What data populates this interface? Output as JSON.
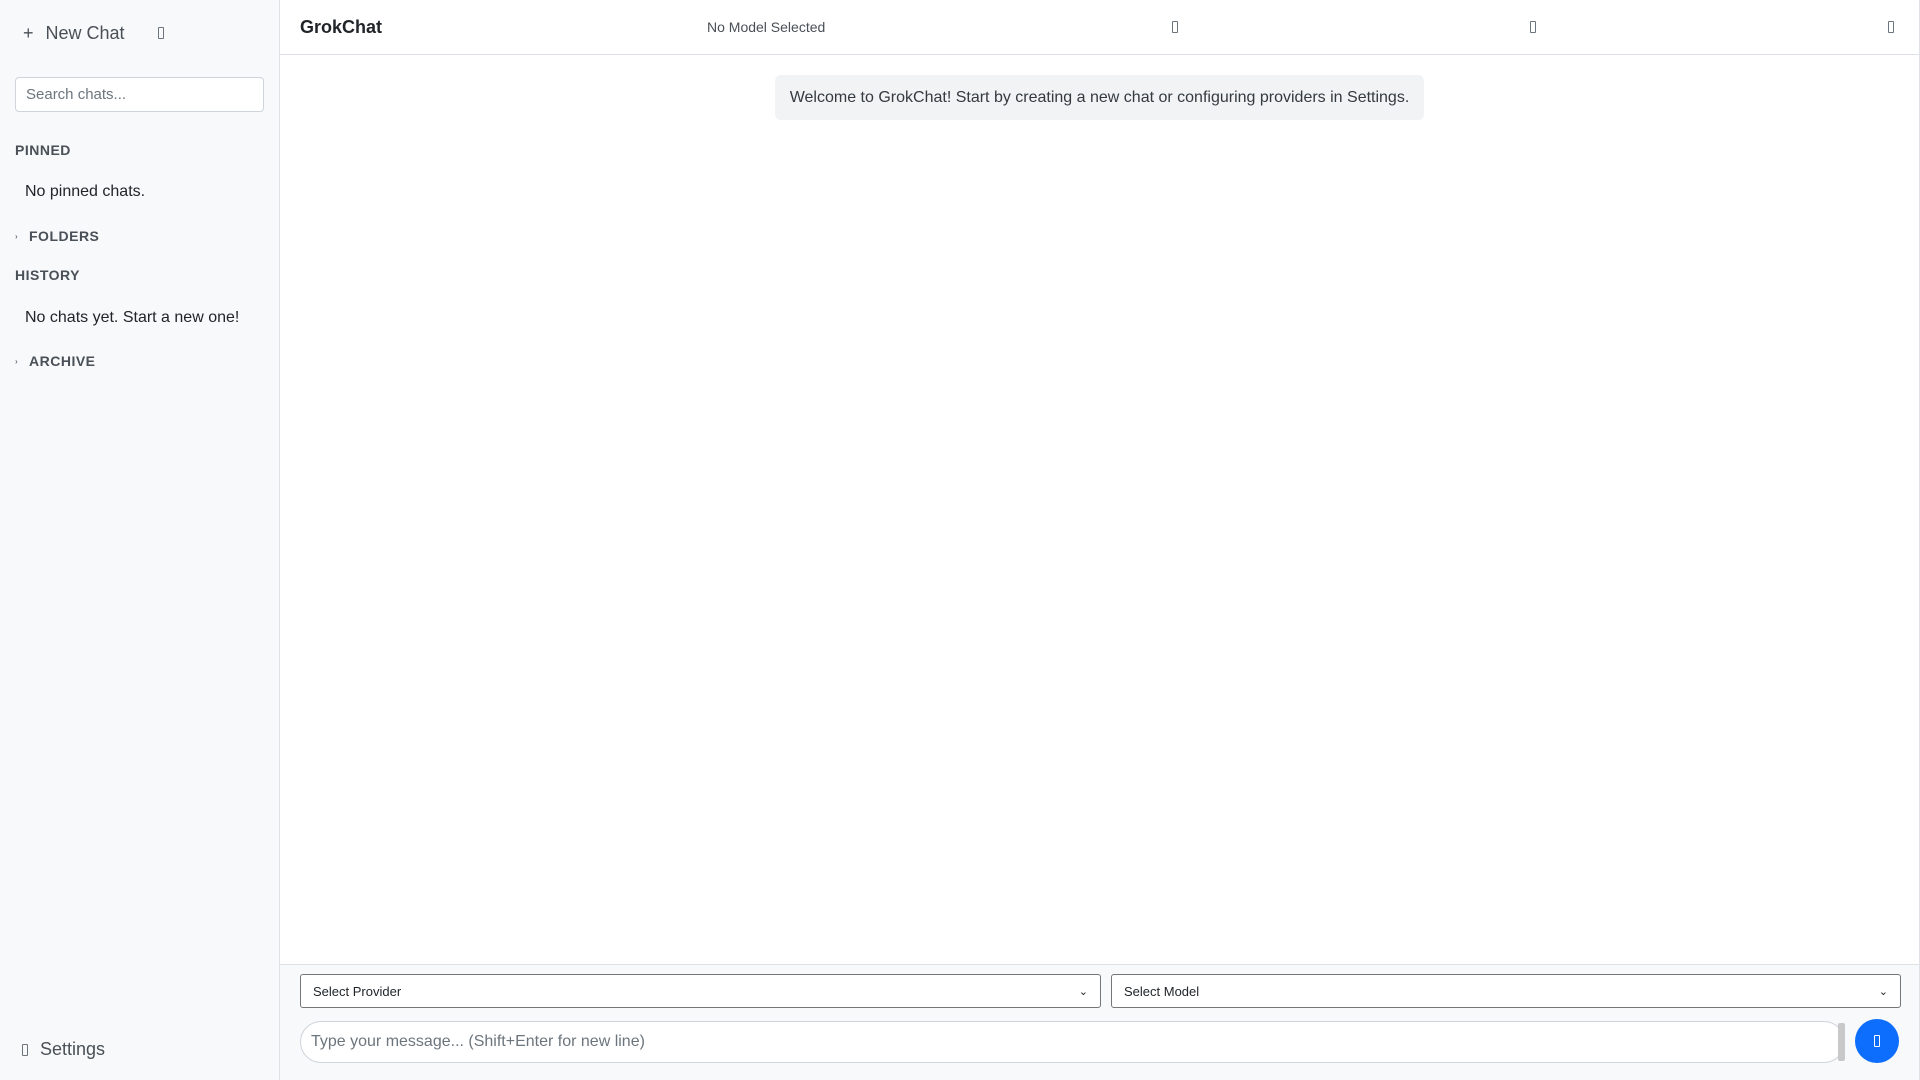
{
  "sidebar": {
    "new_chat_label": "New Chat",
    "search_placeholder": "Search chats...",
    "pinned_title": "PINNED",
    "pinned_empty": "No pinned chats.",
    "folders_title": "FOLDERS",
    "history_title": "HISTORY",
    "history_empty": "No chats yet. Start a new one!",
    "archive_title": "ARCHIVE",
    "settings_label": "Settings"
  },
  "header": {
    "title": "GrokChat",
    "model_status": "No Model Selected"
  },
  "chat": {
    "welcome_message": "Welcome to GrokChat! Start by creating a new chat or configuring providers in Settings."
  },
  "composer": {
    "provider_select": "Select Provider",
    "model_select": "Select Model",
    "message_placeholder": "Type your message... (Shift+Enter for new line)"
  },
  "colors": {
    "accent": "#0d6efd",
    "sidebar_bg": "#f8f9fa",
    "welcome_bg": "#f1f3f5"
  }
}
